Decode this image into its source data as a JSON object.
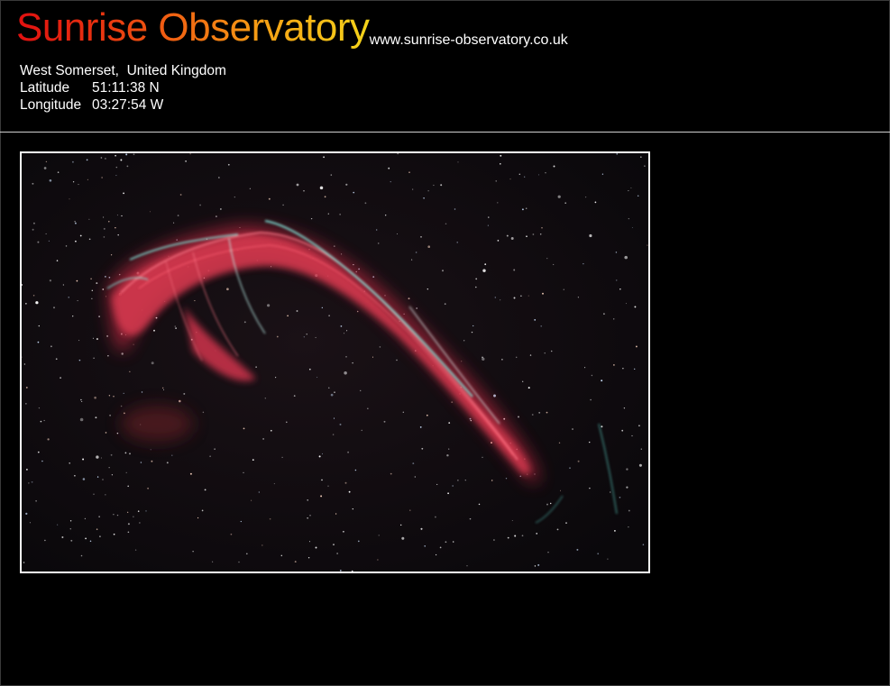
{
  "header": {
    "site_title": "Sunrise Observatory",
    "site_url": "www.sunrise-observatory.co.uk",
    "location": "West Somerset,  United Kingdom",
    "latitude_label": "Latitude",
    "latitude_value": "51:11:38 N",
    "longitude_label": "Longitude",
    "longitude_value": "03:27:54 W"
  },
  "photo": {
    "subject_icon": "nebula-photo",
    "colors": {
      "background": "#0c0a0d",
      "hydrogen_red": "#d2384e",
      "oxygen_teal": "#6ec8c0",
      "frame": "#ffffff"
    }
  },
  "colors": {
    "page_background": "#000000",
    "title_gradient_start": "#e01010",
    "title_gradient_end": "#f4d41a",
    "text": "#ffffff",
    "rule": "#cfcfcf"
  }
}
